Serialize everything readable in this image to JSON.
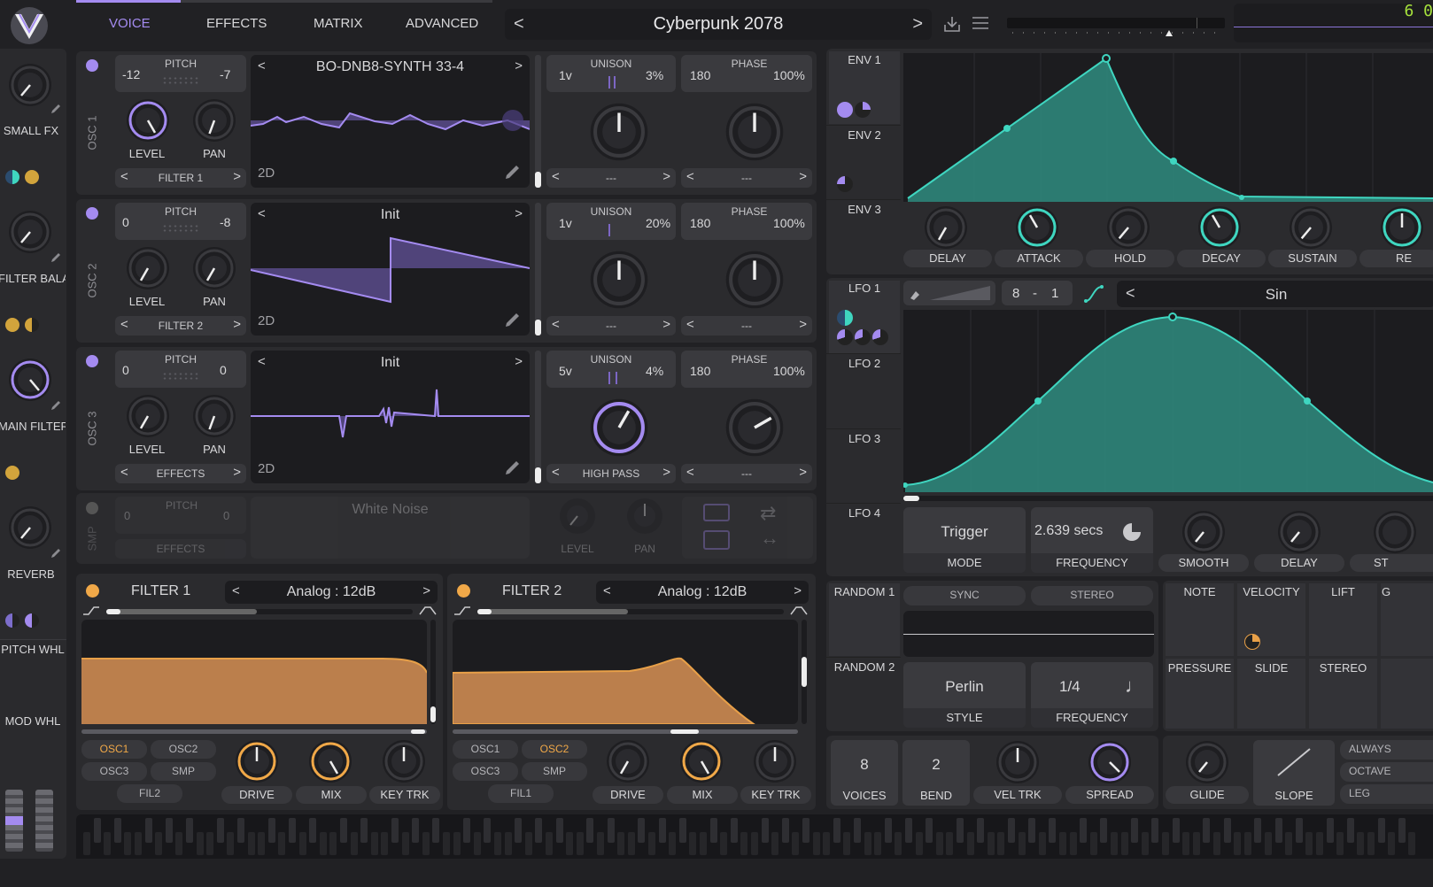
{
  "tabs": [
    "VOICE",
    "EFFECTS",
    "MATRIX",
    "ADVANCED"
  ],
  "preset": {
    "name": "Cyberpunk 2078",
    "prev": "<",
    "next": ">"
  },
  "clock": "6 0",
  "sidebar": [
    {
      "label": "SMALL FX"
    },
    {
      "label": "FILTER BALA"
    },
    {
      "label": "MAIN FILTER"
    },
    {
      "label": "REVERB"
    },
    {
      "label": "PITCH WHL"
    },
    {
      "label": "MOD WHL"
    }
  ],
  "osc": [
    {
      "name": "OSC 1",
      "pitch_label": "PITCH",
      "p1": "-12",
      "p2": "-7",
      "wave": "BO-DNB8-SYNTH 33-4",
      "dest": "FILTER 1",
      "unison_v": "1v",
      "unison_pct": "3%",
      "phase": "180",
      "phase_pct": "100%",
      "uni_sel": "---",
      "phase_sel": "---",
      "dim": "2D"
    },
    {
      "name": "OSC 2",
      "pitch_label": "PITCH",
      "p1": "0",
      "p2": "-8",
      "wave": "Init",
      "dest": "FILTER 2",
      "unison_v": "1v",
      "unison_pct": "20%",
      "phase": "180",
      "phase_pct": "100%",
      "uni_sel": "---",
      "phase_sel": "---",
      "dim": "2D"
    },
    {
      "name": "OSC 3",
      "pitch_label": "PITCH",
      "p1": "0",
      "p2": "0",
      "wave": "Init",
      "dest": "EFFECTS",
      "unison_v": "5v",
      "unison_pct": "4%",
      "phase": "180",
      "phase_pct": "100%",
      "uni_sel": "HIGH PASS",
      "phase_sel": "---",
      "dim": "2D"
    }
  ],
  "common": {
    "level": "LEVEL",
    "pan": "PAN",
    "unison": "UNISON",
    "phase": "PHASE"
  },
  "smp": {
    "name": "SMP",
    "pitch": "PITCH",
    "p1": "0",
    "p2": "0",
    "sample": "White Noise",
    "dest": "EFFECTS",
    "level": "LEVEL",
    "pan": "PAN"
  },
  "filters": [
    {
      "name": "FILTER 1",
      "type": "Analog : 12dB",
      "src": [
        "OSC1",
        "OSC2",
        "OSC3",
        "SMP"
      ],
      "route": "FIL2",
      "drive": "DRIVE",
      "mix": "MIX",
      "keytrk": "KEY TRK"
    },
    {
      "name": "FILTER 2",
      "type": "Analog : 12dB",
      "src": [
        "OSC1",
        "OSC2",
        "OSC3",
        "SMP"
      ],
      "route": "FIL1",
      "drive": "DRIVE",
      "mix": "MIX",
      "keytrk": "KEY TRK"
    }
  ],
  "env": {
    "tabs": [
      "ENV 1",
      "ENV 2",
      "ENV 3"
    ],
    "knobs": [
      "DELAY",
      "ATTACK",
      "HOLD",
      "DECAY",
      "SUSTAIN",
      "RE"
    ]
  },
  "lfo": {
    "tabs": [
      "LFO 1",
      "LFO 2",
      "LFO 3",
      "LFO 4"
    ],
    "tempo_a": "8",
    "tempo_sep": "-",
    "tempo_b": "1",
    "shape": "Sin",
    "mode": "Trigger",
    "mode_label": "MODE",
    "freq": "2.639 secs",
    "freq_label": "FREQUENCY",
    "smooth": "SMOOTH",
    "delay": "DELAY",
    "st": "ST"
  },
  "random": {
    "tabs": [
      "RANDOM 1",
      "RANDOM 2"
    ],
    "sync": "SYNC",
    "stereo": "STEREO",
    "style": "Perlin",
    "style_label": "STYLE",
    "freq": "1/4",
    "freq_label": "FREQUENCY"
  },
  "mpe": {
    "top": [
      "NOTE",
      "VELOCITY",
      "LIFT",
      "G"
    ],
    "bottom": [
      "PRESSURE",
      "SLIDE",
      "STEREO"
    ]
  },
  "voice": {
    "voices": "8",
    "voices_label": "VOICES",
    "bend": "2",
    "bend_label": "BEND",
    "veltrk": "VEL TRK",
    "spread": "SPREAD"
  },
  "glide": {
    "glide": "GLIDE",
    "slope": "SLOPE",
    "opts": [
      "ALWAYS",
      "OCTAVE",
      "LEG"
    ]
  },
  "colors": {
    "accent": "#a48bf0",
    "teal": "#3fd6c0",
    "orange": "#e8a048",
    "bg": "#212124"
  }
}
